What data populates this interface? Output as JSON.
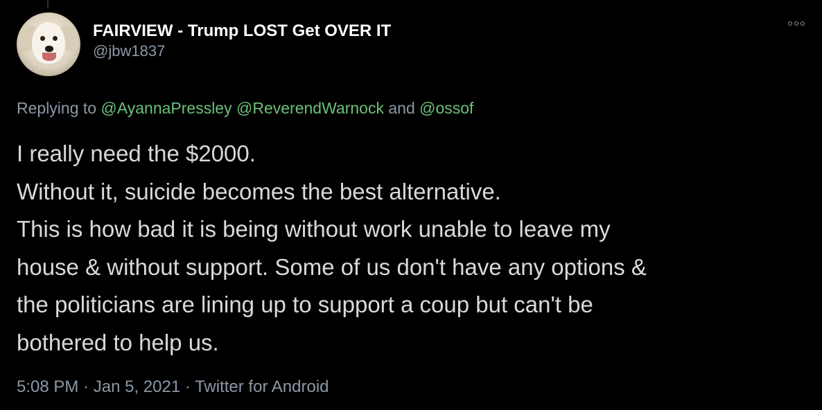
{
  "tweet": {
    "display_name": "FAIRVIEW - Trump LOST Get OVER IT",
    "handle": "@jbw1837",
    "more_icon": "more-horizontal-icon",
    "replying": {
      "prefix": "Replying to",
      "mentions": [
        "@AyannaPressley",
        "@ReverendWarnock",
        "@ossof"
      ],
      "and": "and"
    },
    "body_lines": [
      "I really need the $2000.",
      "Without it, suicide becomes the best alternative.",
      "This is how bad it is being without work unable to leave my",
      "house & without support. Some of us don't have any options &",
      "the politicians are lining up to support a coup but can't be",
      "bothered to help us."
    ],
    "time": "5:08 PM",
    "separator": "·",
    "date": "Jan 5, 2021",
    "source": "Twitter for Android"
  },
  "colors": {
    "background": "#000000",
    "text": "#d9d9d9",
    "secondary": "#8b98a5",
    "mention": "#6cc07a",
    "name": "#ffffff"
  }
}
